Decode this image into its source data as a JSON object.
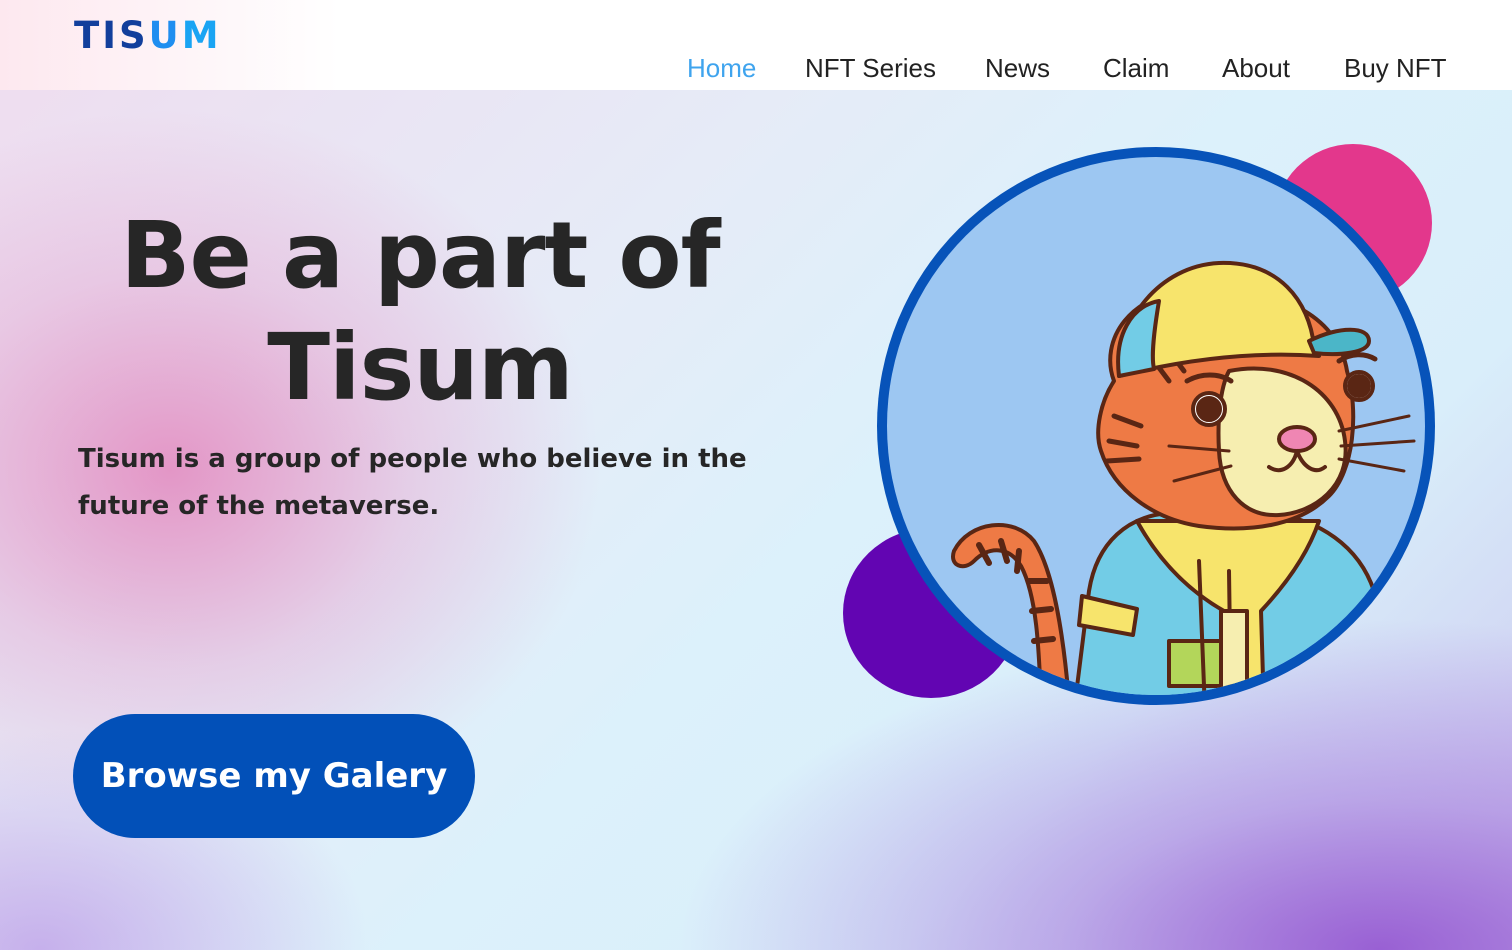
{
  "brand": {
    "logo_part1": "TIS",
    "logo_part2": "U",
    "logo_part3": "M"
  },
  "nav": {
    "items": [
      {
        "label": "Home",
        "active": true
      },
      {
        "label": "NFT Series",
        "active": false
      },
      {
        "label": "News",
        "active": false
      },
      {
        "label": "Claim",
        "active": false
      },
      {
        "label": "About",
        "active": false
      },
      {
        "label": "Buy NFT",
        "active": false
      }
    ]
  },
  "hero": {
    "title_line1": "Be a part of",
    "title_line2": "Tisum",
    "subtitle_line1": "Tisum is a group of people who believe in the",
    "subtitle_line2": "future of the metaverse.",
    "cta_label": "Browse my Galery"
  },
  "illustration": {
    "subject": "tiger-avatar"
  },
  "colors": {
    "brand_dark": "#123f9c",
    "brand_light": "#1aa4f3",
    "nav_active": "#3fa4ee",
    "cta_bg": "#0250b8",
    "bubble_pink": "#e3378c",
    "bubble_purple": "#6205b2",
    "portrait_ring": "#0753b9",
    "portrait_bg": "#9dc7f2"
  }
}
